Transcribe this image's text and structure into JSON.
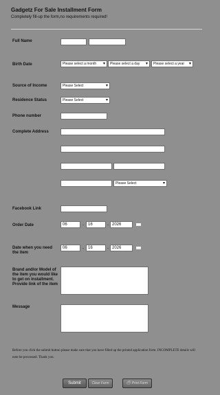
{
  "form": {
    "title": "Gadgetz For Sale Installment Form",
    "subtitle": "Completely fill-up the form,no requirements required!"
  },
  "labels": {
    "full_name": "Full Name",
    "birth_date": "Birth Date",
    "source_income": "Source of Income",
    "residence": "Residence Status",
    "phone": "Phone number",
    "address": "Complete Address",
    "facebook": "Facebook Link",
    "order_date": "Order Date",
    "need_date": "Date when you need the item",
    "brand": "Brand and/or Model of the item you would like to get on installment. Provide link of the item",
    "message": "Message"
  },
  "birth": {
    "month": "Please select a month",
    "day": "Please select a day",
    "year": "Please select a year"
  },
  "selects": {
    "income": "Please Select",
    "residence": "Please Select",
    "address_country": "Please Select"
  },
  "order_date": {
    "month": "06",
    "day": "16",
    "year": "2026"
  },
  "need_date": {
    "month": "06",
    "day": "16",
    "year": "2026"
  },
  "date_sep": "-",
  "note": "Before you click the submit button please make sure that you have filled up the printed application form. INCOMPLETE details will note be processed. Thank you.",
  "buttons": {
    "submit": "Submit",
    "clear": "Clear Form",
    "print": "Print Form"
  },
  "icons": {
    "calendar": "calendar-icon",
    "printer": "printer-icon"
  }
}
